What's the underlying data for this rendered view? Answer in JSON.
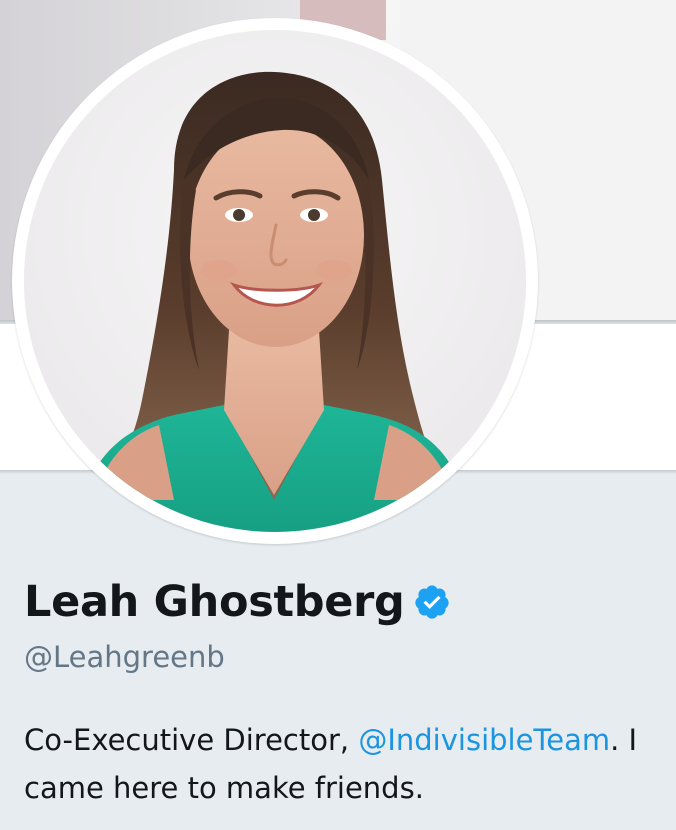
{
  "profile": {
    "display_name": "Leah Ghostberg",
    "handle": "@Leahgreenb",
    "verified": true,
    "bio": {
      "before_mention": "Co-Executive Director, ",
      "mention": "@IndivisibleTeam",
      "after_mention": ". I came here to make friends."
    }
  },
  "icons": {
    "verified": "verified-badge-icon",
    "avatar": "profile-photo"
  },
  "colors": {
    "page_background": "#e6ecf0",
    "name_text": "#14171a",
    "handle_text": "#657786",
    "link": "#1b95e0",
    "verified_badge": "#1da1f2"
  }
}
